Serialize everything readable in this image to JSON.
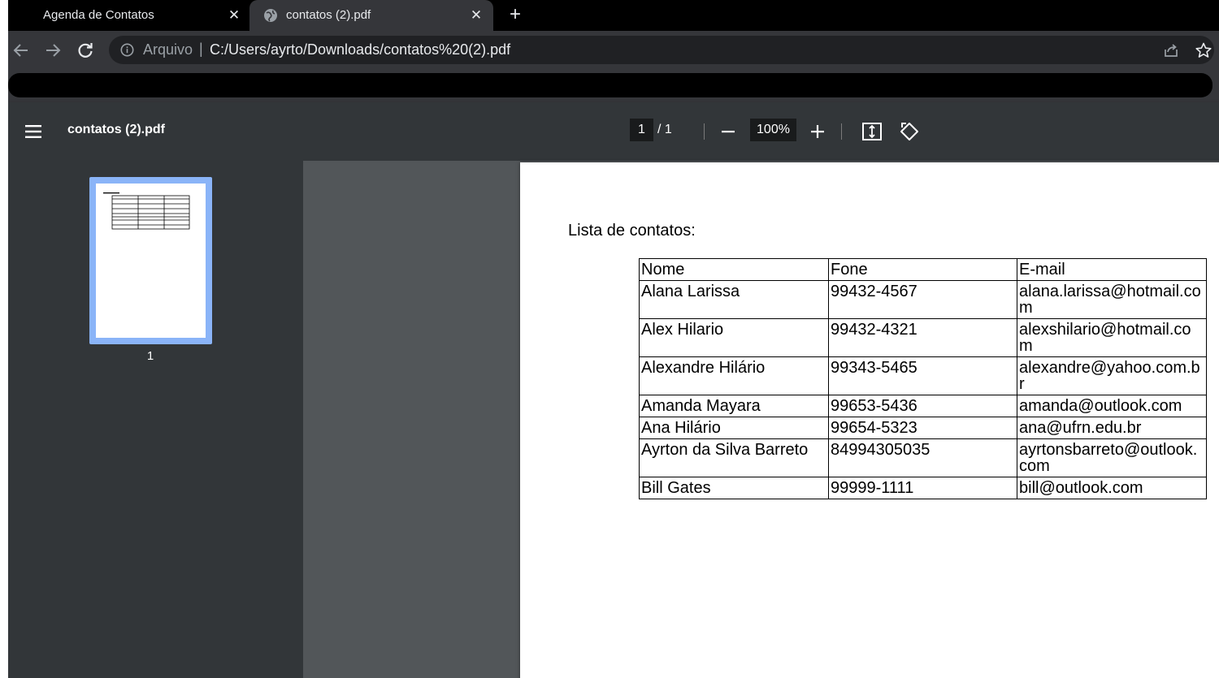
{
  "tabs": [
    {
      "title": "Agenda de Contatos",
      "active": false,
      "close_icon": "close-icon"
    },
    {
      "title": "contatos (2).pdf",
      "active": true,
      "favicon": "globe-icon",
      "close_icon": "close-icon"
    }
  ],
  "toolbar": {
    "scheme_label": "Arquivo",
    "separator": "|",
    "url": "C:/Users/ayrto/Downloads/contatos%20(2).pdf",
    "icons": [
      "back-icon",
      "forward-icon",
      "reload-icon",
      "info-icon",
      "share-icon",
      "star-icon"
    ]
  },
  "pdf_viewer": {
    "title": "contatos (2).pdf",
    "current_page": "1",
    "page_total": "/  1",
    "zoom": "100%",
    "thumbnail_label": "1"
  },
  "document": {
    "heading": "Lista de contatos:",
    "columns": [
      "Nome",
      "Fone",
      "E-mail"
    ],
    "rows": [
      {
        "nome": "Alana Larissa",
        "fone": "99432-4567",
        "email": "alana.larissa@hotmail.com"
      },
      {
        "nome": "Alex Hilario",
        "fone": "99432-4321",
        "email": "alexshilario@hotmail.com"
      },
      {
        "nome": "Alexandre Hilário",
        "fone": "99343-5465",
        "email": "alexandre@yahoo.com.br"
      },
      {
        "nome": "Amanda Mayara",
        "fone": "99653-5436",
        "email": "amanda@outlook.com"
      },
      {
        "nome": "Ana Hilário",
        "fone": "99654-5323",
        "email": "ana@ufrn.edu.br"
      },
      {
        "nome": "Ayrton da Silva Barreto",
        "fone": "84994305035",
        "email": "ayrtonsbarreto@outlook.com"
      },
      {
        "nome": "Bill Gates",
        "fone": "99999-1111",
        "email": "bill@outlook.com"
      }
    ]
  },
  "colors": {
    "tabstrip": "#000000",
    "toolbar": "#35363a",
    "viewer": "#323639",
    "doc_background": "#525659",
    "thumbnail_highlight": "#8ab4f8"
  }
}
